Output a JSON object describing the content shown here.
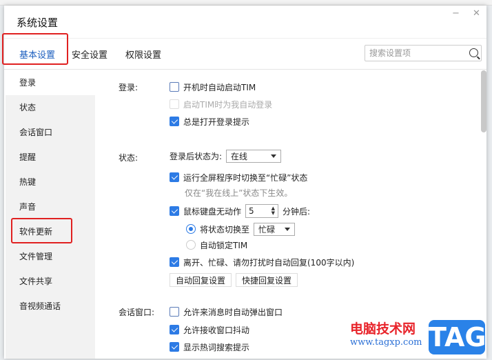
{
  "window": {
    "title": "系统设置",
    "minimize": "−",
    "close": "✕"
  },
  "tabs": [
    {
      "label": "基本设置",
      "active": true
    },
    {
      "label": "安全设置"
    },
    {
      "label": "权限设置"
    }
  ],
  "search": {
    "placeholder": "搜索设置项"
  },
  "sidebar": {
    "items": [
      "登录",
      "状态",
      "会话窗口",
      "提醒",
      "热键",
      "声音",
      "软件更新",
      "文件管理",
      "文件共享",
      "音视频通话"
    ],
    "selected": "登录"
  },
  "login": {
    "label": "登录:",
    "options": [
      {
        "text": "开机时自动启动TIM",
        "checked": false
      },
      {
        "text": "启动TIM时为我自动登录",
        "checked": false,
        "disabled": true
      },
      {
        "text": "总是打开登录提示",
        "checked": true
      }
    ]
  },
  "status": {
    "label": "状态:",
    "after_login_label": "登录后状态为:",
    "after_login_value": "在线",
    "fullscreen": {
      "text": "运行全屏程序时切换至“忙碌”状态",
      "checked": true
    },
    "hint": "仅在“我在线上”状态下生效。",
    "idle": {
      "text": "鼠标键盘无动作",
      "checked": true,
      "minutes": "5",
      "suffix": "分钟后:"
    },
    "switch_to": {
      "text": "将状态切换至",
      "selected": true,
      "value": "忙碌"
    },
    "auto_lock": {
      "text": "自动锁定TIM",
      "selected": false
    },
    "auto_reply": {
      "text": "离开、忙碌、请勿打扰时自动回复(100字以内)",
      "checked": true
    },
    "buttons": [
      "自动回复设置",
      "快捷回复设置"
    ]
  },
  "chat": {
    "label": "会话窗口:",
    "options": [
      {
        "text": "允许来消息时自动弹出窗口",
        "checked": false
      },
      {
        "text": "允许接收窗口抖动",
        "checked": true
      },
      {
        "text": "显示热词搜索提示",
        "checked": true
      }
    ]
  },
  "watermark": {
    "cn": "电脑技术网",
    "url": "www.tagxp.com",
    "tag": "TAG"
  },
  "colors": {
    "accent": "#2d7be5",
    "highlight": "#e02020"
  }
}
